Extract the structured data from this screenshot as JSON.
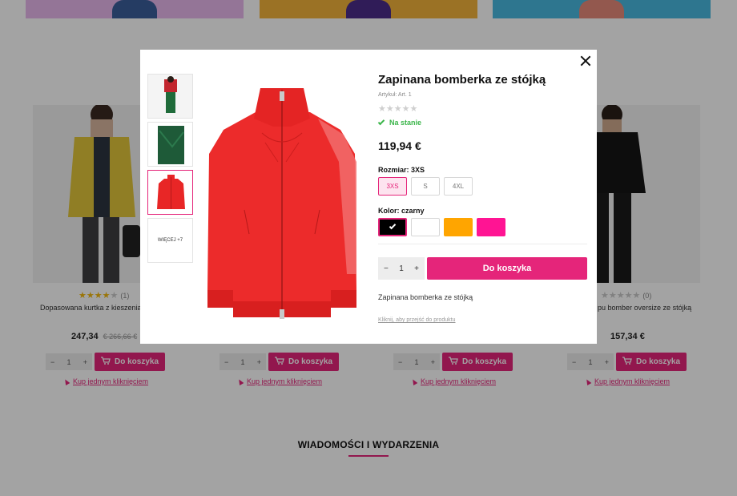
{
  "colors": {
    "accent": "#e5257a",
    "in_stock": "#3bb54a",
    "star": "#f1b80e"
  },
  "background": {
    "products": [
      {
        "name": "Dopasowana kurtka z kieszeniami",
        "rating": 4,
        "rating_count": "(1)",
        "price": "247,34",
        "old_price": "€ 266,66 €"
      },
      {
        "price": ""
      },
      {
        "price": ""
      },
      {
        "name": "bomber oversize ze stójką",
        "name_prefix": "pu",
        "rating": 0,
        "rating_count": "(0)",
        "price": "157,34 €"
      }
    ],
    "qty_value": "1",
    "qty_minus": "−",
    "qty_plus": "+",
    "cart_label": "Do koszyka",
    "one_click_label": "Kup jednym kliknięciem",
    "news_title": "WIADOMOŚCI I WYDARZENIA"
  },
  "modal": {
    "title": "Zapinana bomberka ze stójką",
    "sku": "Artykuł: Art. 1",
    "rating_stars": "★★★★★",
    "stock_status": "Na stanie",
    "price": "119,94 €",
    "size_label": "Rozmiar: 3XS",
    "sizes": [
      "3XS",
      "S",
      "4XL"
    ],
    "selected_size": "3XS",
    "color_label": "Kolor: czarny",
    "colors": [
      {
        "name": "czarny",
        "hex": "#000000",
        "selected": true
      },
      {
        "name": "biały",
        "hex": "#ffffff",
        "selected": false
      },
      {
        "name": "pomarańczowy",
        "hex": "#ffa500",
        "selected": false
      },
      {
        "name": "różowy",
        "hex": "#ff1493",
        "selected": false
      }
    ],
    "qty_value": "1",
    "qty_minus": "−",
    "qty_plus": "+",
    "add_to_cart": "Do koszyka",
    "description": "Zapinana bomberka ze stójką",
    "goto_link": "Kliknij, aby przejść do produktu",
    "more_images": "WIĘCEJ +7",
    "icons": {
      "close": "close-icon",
      "check": "check-icon",
      "cart": "cart-icon"
    }
  }
}
